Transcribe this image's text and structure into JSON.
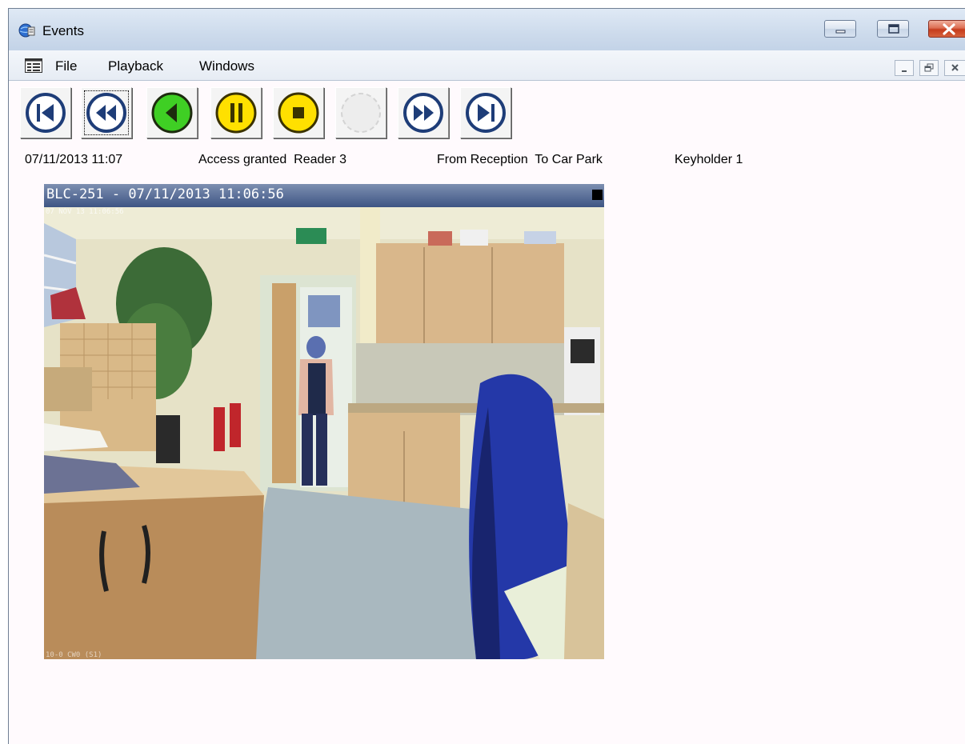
{
  "window": {
    "title": "Events",
    "accent_color": "#cddbec",
    "close_color": "#c53c1c"
  },
  "menu": {
    "items": [
      {
        "label": "File"
      },
      {
        "label": "Playback"
      },
      {
        "label": "Windows"
      }
    ]
  },
  "toolbar": {
    "buttons": [
      {
        "name": "skip-to-start",
        "icon": "skip-start-icon",
        "color": "#ffffff"
      },
      {
        "name": "rewind",
        "icon": "rewind-icon",
        "color": "#ffffff"
      },
      {
        "name": "play-reverse",
        "icon": "play-reverse-icon",
        "color": "#3fcf24"
      },
      {
        "name": "pause",
        "icon": "pause-icon",
        "color": "#ffe000"
      },
      {
        "name": "stop",
        "icon": "stop-icon",
        "color": "#ffe000"
      },
      {
        "name": "play",
        "icon": "play-icon",
        "color": "#ededed"
      },
      {
        "name": "fast-forward",
        "icon": "fast-forward-icon",
        "color": "#ffffff"
      },
      {
        "name": "skip-to-end",
        "icon": "skip-end-icon",
        "color": "#ffffff"
      }
    ]
  },
  "event": {
    "datetime": "07/11/2013 11:07",
    "description": "Access granted  Reader 3",
    "route": "From Reception  To Car Park",
    "user": "Keyholder 1"
  },
  "video": {
    "title": "BLC-251 - 07/11/2013 11:06:56",
    "osd_timestamp": "07 NOV 13 11:06:56",
    "osd_bottom": "10-0 CW0 (S1)",
    "header_color": "#3e5584"
  }
}
